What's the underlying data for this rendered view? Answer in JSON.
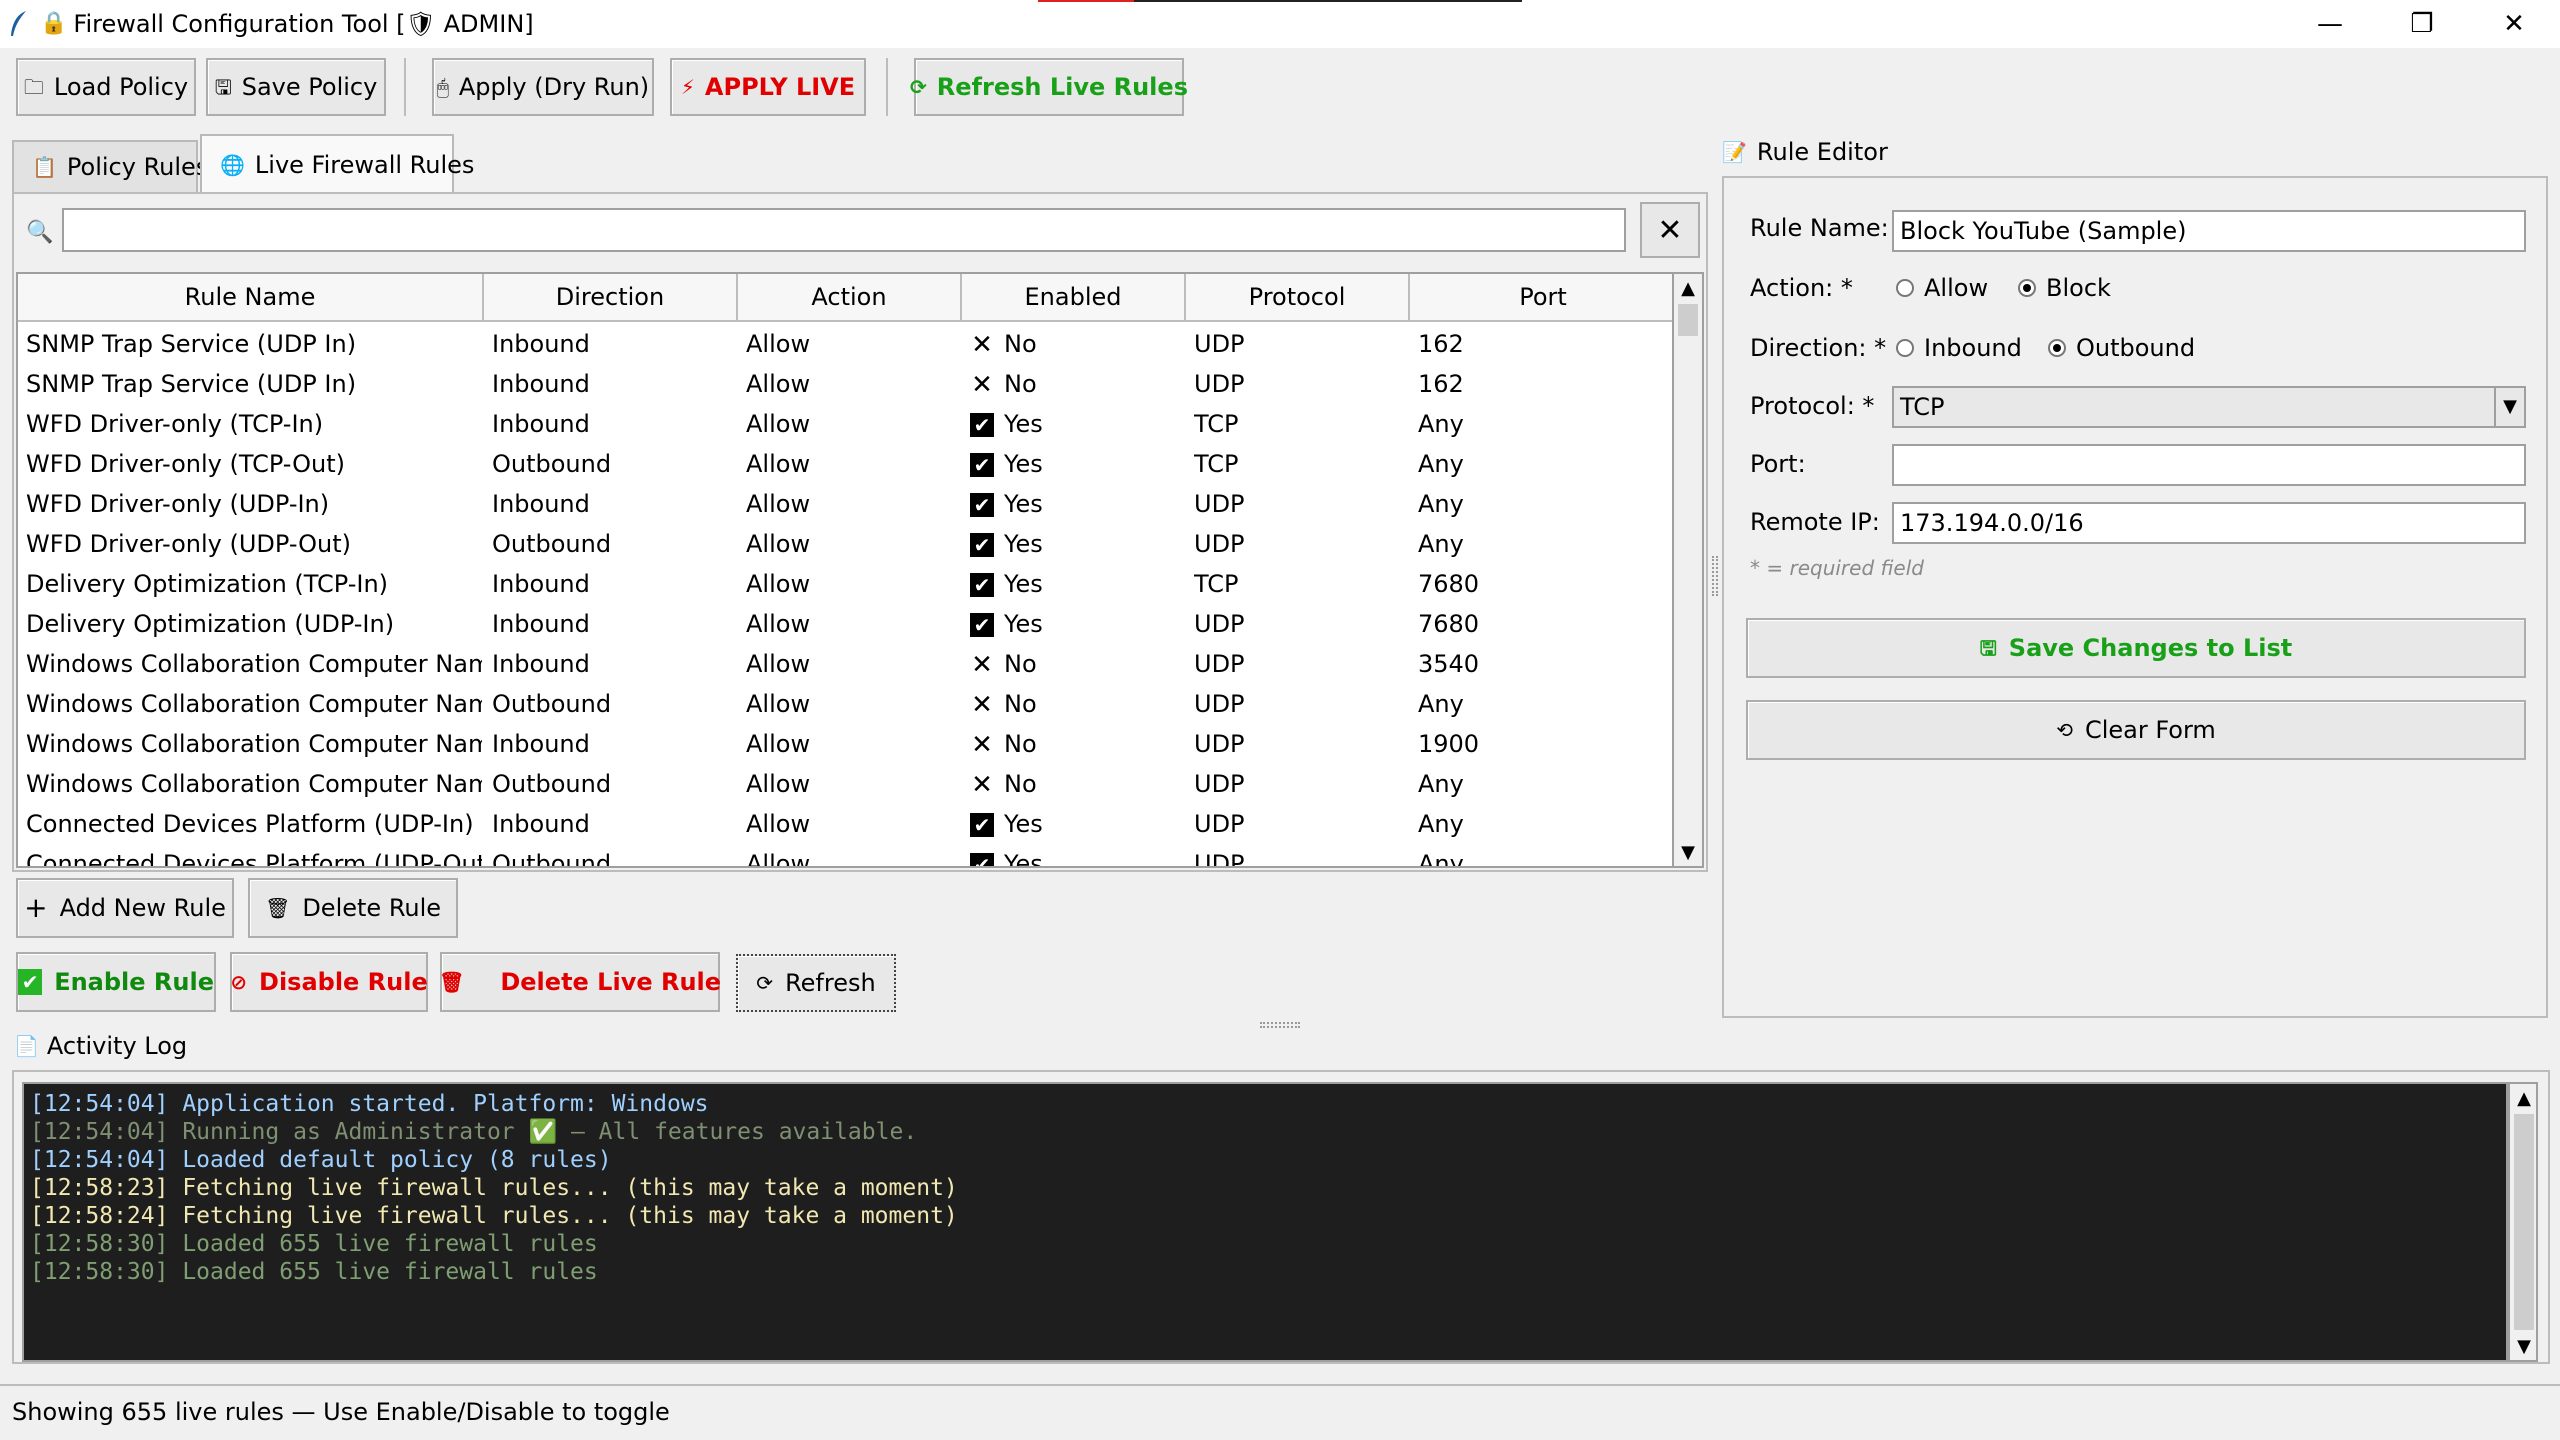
{
  "window": {
    "title": "Firewall Configuration Tool  [🛡 ADMIN]",
    "minimize": "—",
    "maximize": "❐",
    "close": "✕"
  },
  "toolbar": {
    "load_policy": "Load Policy",
    "save_policy": "Save Policy",
    "apply_dry_run": "Apply (Dry Run)",
    "apply_live": "APPLY LIVE",
    "refresh_live_rules": "Refresh Live Rules"
  },
  "tabs": [
    {
      "label": "Policy Rules",
      "icon": "clipboard-icon"
    },
    {
      "label": "Live Firewall Rules",
      "icon": "globe-icon"
    }
  ],
  "search": {
    "value": "",
    "clear_label": "✕"
  },
  "table": {
    "columns": [
      "Rule Name",
      "Direction",
      "Action",
      "Enabled",
      "Protocol",
      "Port"
    ],
    "rows": [
      {
        "name": "SNMP Trap Service (UDP In)",
        "direction": "Inbound",
        "action": "Allow",
        "enabled": "No",
        "enabled_mark": "✕",
        "protocol": "UDP",
        "port": "162"
      },
      {
        "name": "SNMP Trap Service (UDP In)",
        "direction": "Inbound",
        "action": "Allow",
        "enabled": "No",
        "enabled_mark": "✕",
        "protocol": "UDP",
        "port": "162"
      },
      {
        "name": "WFD Driver-only (TCP-In)",
        "direction": "Inbound",
        "action": "Allow",
        "enabled": "Yes",
        "enabled_mark": "✔",
        "protocol": "TCP",
        "port": "Any"
      },
      {
        "name": "WFD Driver-only (TCP-Out)",
        "direction": "Outbound",
        "action": "Allow",
        "enabled": "Yes",
        "enabled_mark": "✔",
        "protocol": "TCP",
        "port": "Any"
      },
      {
        "name": "WFD Driver-only (UDP-In)",
        "direction": "Inbound",
        "action": "Allow",
        "enabled": "Yes",
        "enabled_mark": "✔",
        "protocol": "UDP",
        "port": "Any"
      },
      {
        "name": "WFD Driver-only (UDP-Out)",
        "direction": "Outbound",
        "action": "Allow",
        "enabled": "Yes",
        "enabled_mark": "✔",
        "protocol": "UDP",
        "port": "Any"
      },
      {
        "name": "Delivery Optimization (TCP-In)",
        "direction": "Inbound",
        "action": "Allow",
        "enabled": "Yes",
        "enabled_mark": "✔",
        "protocol": "TCP",
        "port": "7680"
      },
      {
        "name": "Delivery Optimization (UDP-In)",
        "direction": "Inbound",
        "action": "Allow",
        "enabled": "Yes",
        "enabled_mark": "✔",
        "protocol": "UDP",
        "port": "7680"
      },
      {
        "name": "Windows Collaboration Computer Name R",
        "direction": "Inbound",
        "action": "Allow",
        "enabled": "No",
        "enabled_mark": "✕",
        "protocol": "UDP",
        "port": "3540"
      },
      {
        "name": "Windows Collaboration Computer Name R",
        "direction": "Outbound",
        "action": "Allow",
        "enabled": "No",
        "enabled_mark": "✕",
        "protocol": "UDP",
        "port": "Any"
      },
      {
        "name": "Windows Collaboration Computer Name R",
        "direction": "Inbound",
        "action": "Allow",
        "enabled": "No",
        "enabled_mark": "✕",
        "protocol": "UDP",
        "port": "1900"
      },
      {
        "name": "Windows Collaboration Computer Name R",
        "direction": "Outbound",
        "action": "Allow",
        "enabled": "No",
        "enabled_mark": "✕",
        "protocol": "UDP",
        "port": "Any"
      },
      {
        "name": "Connected Devices Platform (UDP-In)",
        "direction": "Inbound",
        "action": "Allow",
        "enabled": "Yes",
        "enabled_mark": "✔",
        "protocol": "UDP",
        "port": "Any"
      },
      {
        "name": "Connected Devices Platform (UDP-Out)",
        "direction": "Outbound",
        "action": "Allow",
        "enabled": "Yes",
        "enabled_mark": "✔",
        "protocol": "UDP",
        "port": "Any"
      }
    ]
  },
  "actions": {
    "add_new_rule": "Add New Rule",
    "delete_rule": "Delete Rule",
    "enable_rule": "Enable Rule",
    "disable_rule": "Disable Rule",
    "delete_live_rule": "Delete Live Rule",
    "refresh": "Refresh"
  },
  "editor": {
    "title": "Rule Editor",
    "rule_name_label": "Rule Name: *",
    "rule_name_value": "Block YouTube (Sample)",
    "action_label": "Action: *",
    "action_options": [
      "Allow",
      "Block"
    ],
    "action_selected": "Block",
    "direction_label": "Direction: *",
    "direction_options": [
      "Inbound",
      "Outbound"
    ],
    "direction_selected": "Outbound",
    "protocol_label": "Protocol: *",
    "protocol_value": "TCP",
    "port_label": "Port:",
    "port_value": "",
    "remote_ip_label": "Remote IP:",
    "remote_ip_value": "173.194.0.0/16",
    "required_note": "* = required field",
    "save_changes": "Save Changes to List",
    "clear_form": "Clear Form"
  },
  "log": {
    "title": "Activity Log",
    "lines": [
      {
        "text": "[12:54:04] Application started. Platform: Windows",
        "color": "#9fd0ff"
      },
      {
        "text": "[12:54:04] Running as Administrator ✅ — All features available.",
        "color": "#7f8f72"
      },
      {
        "text": "[12:54:04] Loaded default policy (8 rules)",
        "color": "#9fd0ff"
      },
      {
        "text": "[12:58:23] Fetching live firewall rules... (this may take a moment)",
        "color": "#f1e7b0"
      },
      {
        "text": "[12:58:24] Fetching live firewall rules... (this may take a moment)",
        "color": "#f1e7b0"
      },
      {
        "text": "[12:58:30] Loaded 655 live firewall rules",
        "color": "#7f9f72"
      },
      {
        "text": "[12:58:30] Loaded 655 live firewall rules",
        "color": "#7f9f72"
      }
    ]
  },
  "status": {
    "text": "Showing 655 live rules — Use Enable/Disable to toggle"
  },
  "colors": {
    "live_red": "#e00000",
    "refresh_green": "#18a018",
    "enable_green": "#0f8a0f",
    "check_bg": "#26b526"
  }
}
